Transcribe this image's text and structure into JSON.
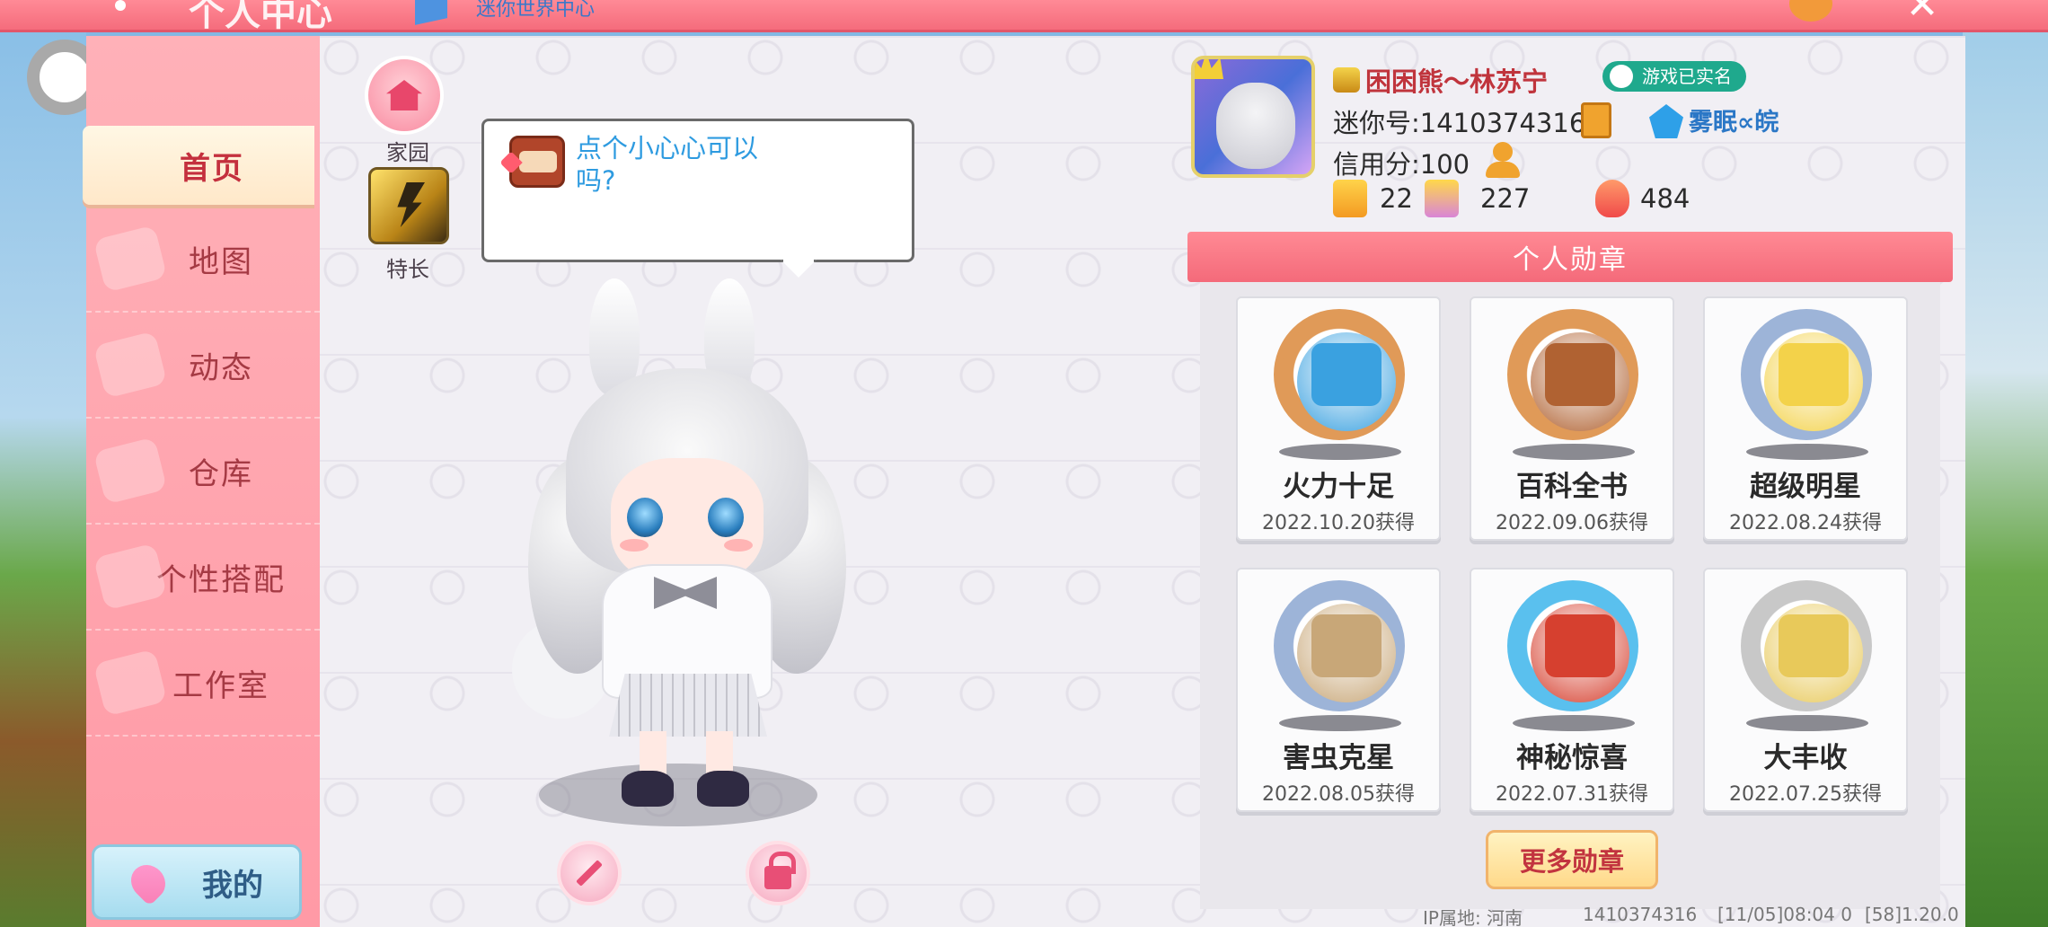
{
  "topbar": {
    "title": "个人中心",
    "tab_text": "迷你世界中心"
  },
  "sidebar": {
    "items": [
      {
        "label": "首页",
        "active": true
      },
      {
        "label": "地图"
      },
      {
        "label": "动态"
      },
      {
        "label": "仓库"
      },
      {
        "label": "个性搭配"
      },
      {
        "label": "工作室"
      }
    ],
    "mine_label": "我的"
  },
  "shortcuts": {
    "home_label": "家园",
    "skill_label": "特长"
  },
  "speech_bubble": {
    "text": "点个小心心可以吗?"
  },
  "profile": {
    "username": "困困熊～林苏宁",
    "verified_badge": "游戏已实名",
    "mini_id_text": "迷你号:1410374316",
    "credit_text": "信用分:100",
    "team_name": "雾眠∝皖",
    "stats": {
      "stat1": "22",
      "stat2": "227",
      "stat3": "484"
    }
  },
  "badges": {
    "header": "个人勋章",
    "items": [
      {
        "name": "火力十足",
        "date": "2022.10.20获得",
        "ring": "#e09a58",
        "core": "#3aa1e0"
      },
      {
        "name": "百科全书",
        "date": "2022.09.06获得",
        "ring": "#e09a58",
        "core": "#b06232"
      },
      {
        "name": "超级明星",
        "date": "2022.08.24获得",
        "ring": "#9db4d8",
        "core": "#f3d24a"
      },
      {
        "name": "害虫克星",
        "date": "2022.08.05获得",
        "ring": "#9db4d8",
        "core": "#c8a778"
      },
      {
        "name": "神秘惊喜",
        "date": "2022.07.31获得",
        "ring": "#5ac0ee",
        "core": "#d6402f"
      },
      {
        "name": "大丰收",
        "date": "2022.07.25获得",
        "ring": "#c8c8c8",
        "core": "#e8c95a"
      }
    ],
    "more_label": "更多勋章"
  },
  "footer": {
    "ip_text": "IP属地: 河南",
    "uid_text": "1410374316",
    "time_text": "[11/05]08:04 0",
    "version_text": "[58]1.20.0"
  },
  "colors": {
    "accent": "#f56c7c",
    "sidebar": "#ff9aa6",
    "title_red": "#c4303e"
  }
}
